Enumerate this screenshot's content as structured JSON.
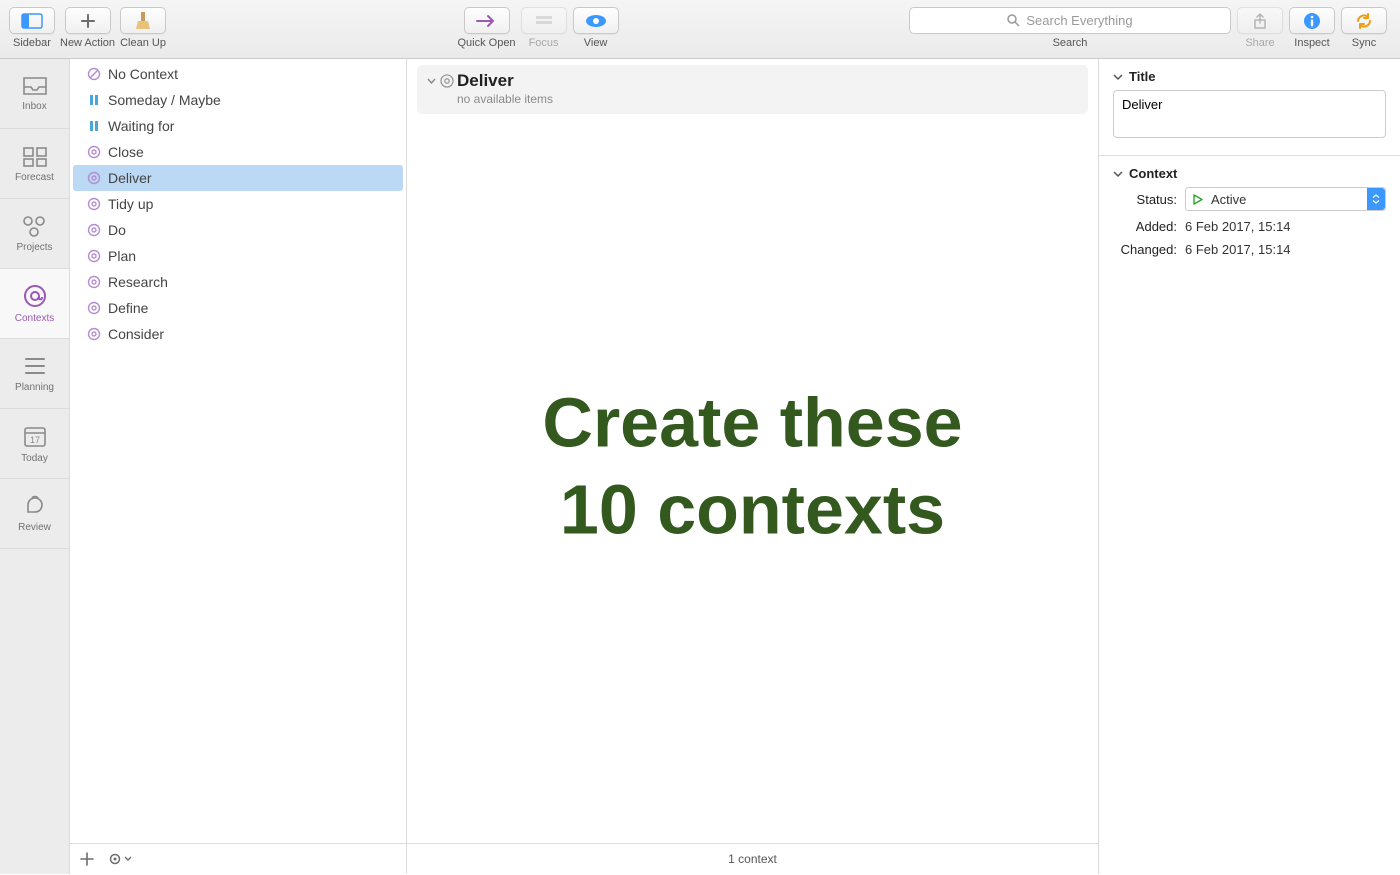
{
  "toolbar": {
    "sidebar": "Sidebar",
    "new_action": "New Action",
    "clean_up": "Clean Up",
    "quick_open": "Quick Open",
    "focus": "Focus",
    "view": "View",
    "search_label": "Search",
    "search_placeholder": "Search Everything",
    "share": "Share",
    "inspect": "Inspect",
    "sync": "Sync"
  },
  "rail": {
    "inbox": "Inbox",
    "forecast": "Forecast",
    "projects": "Projects",
    "contexts": "Contexts",
    "planning": "Planning",
    "today": "Today",
    "today_number": "17",
    "review": "Review"
  },
  "contexts": [
    {
      "label": "No Context",
      "type": "none"
    },
    {
      "label": "Someday / Maybe",
      "type": "hold"
    },
    {
      "label": "Waiting for",
      "type": "hold"
    },
    {
      "label": "Close",
      "type": "ctx"
    },
    {
      "label": "Deliver",
      "type": "ctx",
      "selected": true
    },
    {
      "label": "Tidy up",
      "type": "ctx"
    },
    {
      "label": "Do",
      "type": "ctx"
    },
    {
      "label": "Plan",
      "type": "ctx"
    },
    {
      "label": "Research",
      "type": "ctx"
    },
    {
      "label": "Define",
      "type": "ctx"
    },
    {
      "label": "Consider",
      "type": "ctx"
    }
  ],
  "center": {
    "title": "Deliver",
    "subtitle": "no available items",
    "footer": "1 context"
  },
  "overlay": {
    "line1": "Create these",
    "line2": "10 contexts"
  },
  "inspector": {
    "title_section": "Title",
    "title_value": "Deliver",
    "context_section": "Context",
    "status_label": "Status:",
    "status_value": "Active",
    "added_label": "Added:",
    "added_value": "6 Feb 2017, 15:14",
    "changed_label": "Changed:",
    "changed_value": "6 Feb 2017, 15:14"
  }
}
